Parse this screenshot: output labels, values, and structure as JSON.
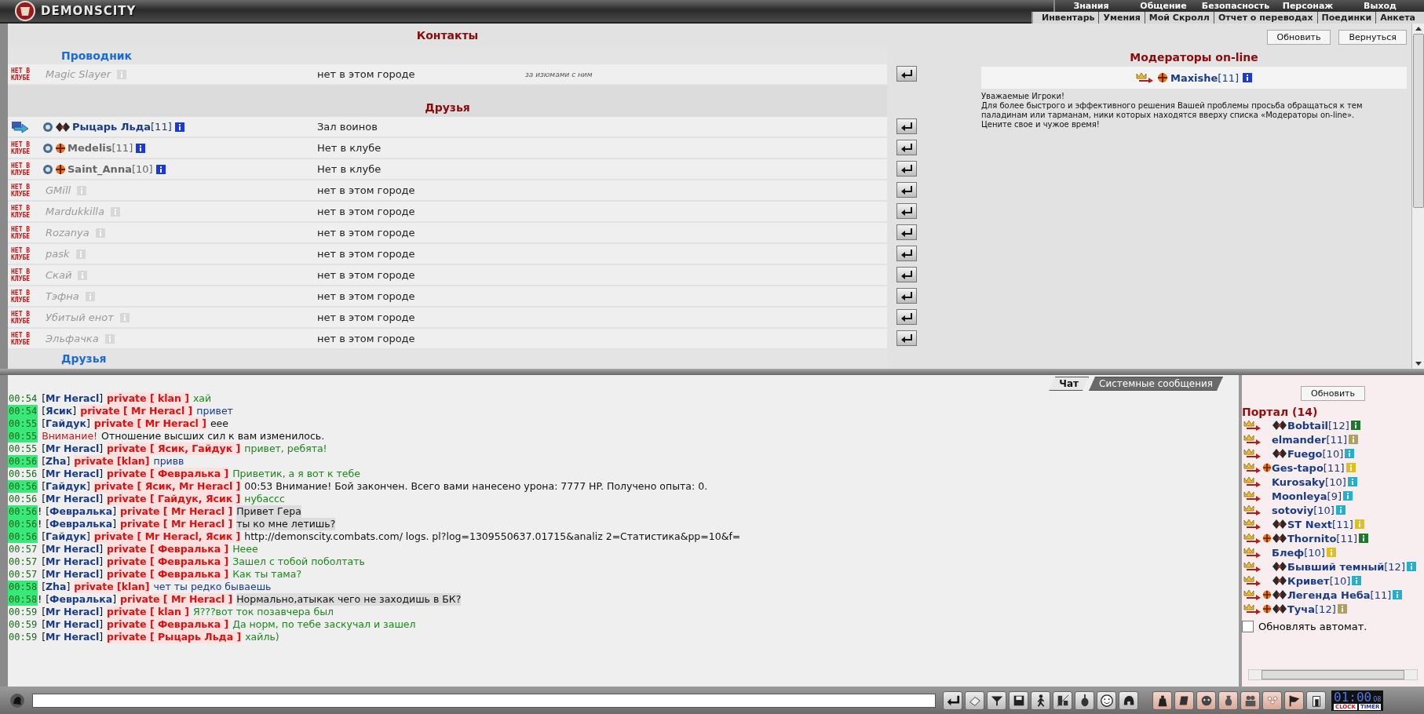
{
  "header": {
    "logo": "DEMONSCITY",
    "menu": [
      "Знания",
      "Общение",
      "Безопасность",
      "Персонаж",
      "Выход"
    ],
    "submenu": [
      "Инвентарь",
      "Умения",
      "Мой Скролл",
      "Отчет о переводах",
      "Поединки",
      "Анкета"
    ]
  },
  "contacts": {
    "title": "Контакты",
    "rows": [
      {
        "kind": "group",
        "label": "Проводник"
      },
      {
        "kind": "contact",
        "in_club": false,
        "online": false,
        "badge": "НЕТ В КЛУБЕ",
        "name": "Magic Slayer",
        "location": "нет в этом городе",
        "note": "за изюмами с ним"
      },
      {
        "kind": "section",
        "label": "Друзья"
      },
      {
        "kind": "contact",
        "in_club": true,
        "online": true,
        "emblems": [
          {
            "kind": "mark"
          },
          {
            "kind": "clan"
          }
        ],
        "name": "Рыцарь Льда",
        "level": "[11]",
        "location": "Зал воинов"
      },
      {
        "kind": "contact",
        "in_club": false,
        "online": true,
        "badge": "НЕТ В КЛУБЕ",
        "emblems": [
          {
            "kind": "mark"
          },
          {
            "kind": "order"
          }
        ],
        "name": "Medelis",
        "level": "[11]",
        "location": "Нет в клубе"
      },
      {
        "kind": "contact",
        "in_club": false,
        "online": true,
        "badge": "НЕТ В КЛУБЕ",
        "emblems": [
          {
            "kind": "mark"
          },
          {
            "kind": "order"
          }
        ],
        "name": "Saint_Anna",
        "level": "[10]",
        "location": "Нет в клубе"
      },
      {
        "kind": "contact",
        "in_club": false,
        "online": false,
        "badge": "НЕТ В КЛУБЕ",
        "name": "GMill",
        "location": "нет в этом городе"
      },
      {
        "kind": "contact",
        "in_club": false,
        "online": false,
        "badge": "НЕТ В КЛУБЕ",
        "name": "Mardukkilla",
        "location": "нет в этом городе"
      },
      {
        "kind": "contact",
        "in_club": false,
        "online": false,
        "badge": "НЕТ В КЛУБЕ",
        "name": "Rozanya",
        "location": "нет в этом городе"
      },
      {
        "kind": "contact",
        "in_club": false,
        "online": false,
        "badge": "НЕТ В КЛУБЕ",
        "name": "pask",
        "location": "нет в этом городе"
      },
      {
        "kind": "contact",
        "in_club": false,
        "online": false,
        "badge": "НЕТ В КЛУБЕ",
        "name": "Скай",
        "location": "нет в этом городе"
      },
      {
        "kind": "contact",
        "in_club": false,
        "online": false,
        "badge": "НЕТ В КЛУБЕ",
        "name": "Тэфна",
        "location": "нет в этом городе"
      },
      {
        "kind": "contact",
        "in_club": false,
        "online": false,
        "badge": "НЕТ В КЛУБЕ",
        "name": "Убитый енот",
        "location": "нет в этом городе"
      },
      {
        "kind": "contact",
        "in_club": false,
        "online": false,
        "badge": "НЕТ В КЛУБЕ",
        "name": "Эльфачка",
        "location": "нет в этом городе"
      },
      {
        "kind": "group",
        "label": "Друзья"
      }
    ]
  },
  "moderators": {
    "buttons": [
      "Обновить",
      "Вернуться"
    ],
    "title": "Модераторы on-line",
    "list": [
      {
        "name": "Maxishe",
        "level": "[11]",
        "emblems": [
          {
            "kind": "order"
          }
        ]
      }
    ],
    "notice": [
      "Уважаемые Игроки!",
      "Для более быстрого и эффективного решения Вашей проблемы просьба обращаться к тем паладинам или тарманам, ники которых находятся вверху списка «Модераторы on-line».",
      "Цените свое и чужое время!"
    ]
  },
  "chat": {
    "tabs": [
      {
        "label": "Чат",
        "selected": true
      },
      {
        "label": "Системные сообщения",
        "selected": false
      }
    ],
    "messages": [
      {
        "kind": "own",
        "time": "00:54",
        "highlight": false,
        "sender": "[**Mr Heracl**]",
        "to": "private [ klan ]",
        "text": "хай"
      },
      {
        "kind": "incoming",
        "time": "00:54",
        "highlight": true,
        "sender": "[**Ясик**]",
        "to": "private [ Mr Heracl ]",
        "text": "привет"
      },
      {
        "kind": "plain",
        "time": "00:55",
        "highlight": true,
        "sender": "[**Гайдук**]",
        "to": "private [ Mr Heracl ]",
        "text": "еее"
      },
      {
        "kind": "system",
        "time": "00:55",
        "highlight": true,
        "label": "Внимание!",
        "text": "Отношение высших сил к вам изменилось."
      },
      {
        "kind": "own",
        "time": "00:55",
        "highlight": false,
        "sender": "[**Mr Heracl**]",
        "to": "private [ Ясик, Гайдук ]",
        "text": "привет, ребята!"
      },
      {
        "kind": "incoming",
        "time": "00:56",
        "highlight": true,
        "sender": "[**Zha**]",
        "to": "private [klan]",
        "text": "привв"
      },
      {
        "kind": "own",
        "time": "00:56",
        "highlight": false,
        "sender": "[**Mr Heracl**]",
        "to": "private [ Февралька ]",
        "text": "Приветик, а я вот к тебе"
      },
      {
        "kind": "plain",
        "time": "00:56",
        "highlight": true,
        "sender": "[**Гайдук**]",
        "to": "private [ Ясик, Mr Heracl ]",
        "text": "00:53 Внимание! Бой закончен. Всего вами нанесено урона: 7777 HP. Получено опыта: 0."
      },
      {
        "kind": "own",
        "time": "00:56",
        "highlight": false,
        "sender": "[**Mr Heracl**]",
        "to": "private [ Гайдук, Ясик ]",
        "text": "нубассс"
      },
      {
        "kind": "marked",
        "time": "00:56",
        "highlight": true,
        "mark": "!",
        "sender": "[**Февралька**]",
        "to": "private [ Mr Heracl ]",
        "text": "Привет Гера"
      },
      {
        "kind": "marked",
        "time": "00:56",
        "highlight": true,
        "mark": "!",
        "sender": "[**Февралька**]",
        "to": "private [ Mr Heracl ]",
        "text": "ты ко мне летишь?"
      },
      {
        "kind": "plain",
        "time": "00:56",
        "highlight": true,
        "sender": "[**Гайдук**]",
        "to": "private [ Mr Heracl, Ясик ]",
        "text": "http://demonscity.combats.com/ logs. pl?log=1309550637.01715&analiz 2=Статистика&pp=10&f="
      },
      {
        "kind": "own",
        "time": "00:57",
        "highlight": false,
        "sender": "[**Mr Heracl**]",
        "to": "private [ Февралька ]",
        "text": "Нееe"
      },
      {
        "kind": "own",
        "time": "00:57",
        "highlight": false,
        "sender": "[**Mr Heracl**]",
        "to": "private [ Февралька ]",
        "text": "Зашел с тобой поболтать"
      },
      {
        "kind": "own",
        "time": "00:57",
        "highlight": false,
        "sender": "[**Mr Heracl**]",
        "to": "private [ Февралька ]",
        "text": "Как ты тама?"
      },
      {
        "kind": "incoming",
        "time": "00:58",
        "highlight": true,
        "sender": "[**Zha**]",
        "to": "private [klan]",
        "text": "чет ты редко бываешь"
      },
      {
        "kind": "marked",
        "time": "00:58",
        "highlight": true,
        "mark": "!",
        "sender": "[**Февралька**]",
        "to": "private [ Mr Heracl ]",
        "text": "Нормально,атыкак чего не заходишь в БК?"
      },
      {
        "kind": "own",
        "time": "00:59",
        "highlight": false,
        "sender": "[**Mr Heracl**]",
        "to": "private [ klan ]",
        "text": "Я???вот ток позавчера был"
      },
      {
        "kind": "own",
        "time": "00:59",
        "highlight": false,
        "sender": "[**Mr Heracl**]",
        "to": "private [ Февралька ]",
        "text": "Да норм, по тебе заскучал и зашел"
      },
      {
        "kind": "own",
        "time": "00:59",
        "highlight": false,
        "sender": "[**Mr Heracl**]",
        "to": "private [ Рыцарь Льда ]",
        "text": "хайль)"
      }
    ]
  },
  "portal": {
    "button": "Обновить",
    "title": "Портал (14)",
    "users": [
      {
        "name": "Bobtail",
        "level": "[12]",
        "color": "#1a7a2a",
        "emblems": [
          {
            "kind": "clan"
          }
        ]
      },
      {
        "name": "elmander",
        "level": "[11]",
        "color": "#b0a060"
      },
      {
        "name": "Fuego",
        "level": "[10]",
        "color": "#20b0d0",
        "emblems": [
          {
            "kind": "clan"
          }
        ]
      },
      {
        "name": "Ges-tapo",
        "level": "[11]",
        "color": "#e0c020",
        "emblems": [
          {
            "kind": "order"
          }
        ]
      },
      {
        "name": "Kurosaky",
        "level": "[10]",
        "color": "#20b0d0"
      },
      {
        "name": "Moonleya",
        "level": "[9]",
        "color": "#20b0d0"
      },
      {
        "name": "sotoviy",
        "level": "[10]",
        "color": "#20b0d0"
      },
      {
        "name": "ST Next",
        "level": "[11]",
        "color": "#e0c020",
        "emblems": [
          {
            "kind": "clan"
          }
        ]
      },
      {
        "name": "Thornito",
        "level": "[11]",
        "color": "#1a7a2a",
        "emblems": [
          {
            "kind": "order"
          },
          {
            "kind": "clan"
          }
        ]
      },
      {
        "name": "Блеф",
        "level": "[10]",
        "color": "#e0c020"
      },
      {
        "name": "Бывший темный",
        "level": "[12]",
        "color": "#20b0d0",
        "emblems": [
          {
            "kind": "clan"
          }
        ]
      },
      {
        "name": "Кривет",
        "level": "[10]",
        "color": "#20b0d0",
        "emblems": [
          {
            "kind": "clan"
          }
        ]
      },
      {
        "name": "Легенда Неба",
        "level": "[11]",
        "color": "#20b0d0",
        "emblems": [
          {
            "kind": "order"
          },
          {
            "kind": "clan"
          }
        ]
      },
      {
        "name": "Туча",
        "level": "[12]",
        "color": "#b0a060",
        "emblems": [
          {
            "kind": "order"
          },
          {
            "kind": "clan"
          }
        ]
      }
    ],
    "auto_update": {
      "label": "Обновлять автомат.",
      "checked": false
    }
  },
  "clock": {
    "time": "01:00",
    "seconds": "08",
    "labels": [
      "CLOCK",
      "TIMER"
    ]
  }
}
